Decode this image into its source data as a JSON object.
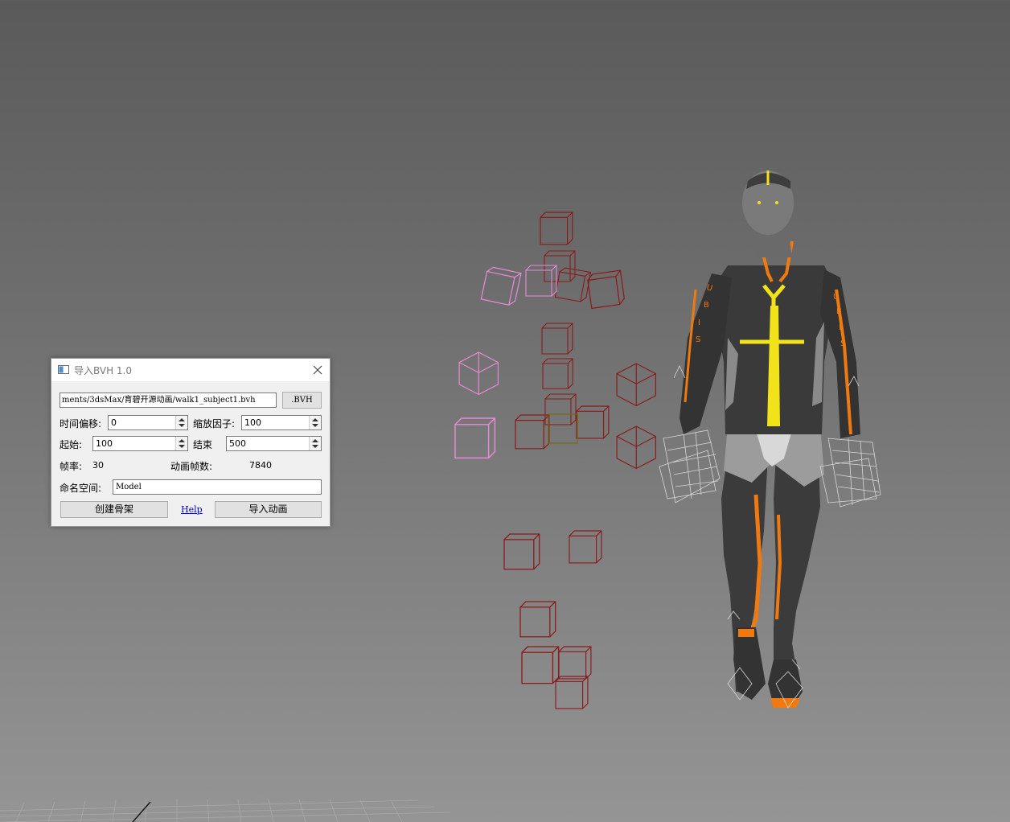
{
  "dialog": {
    "title": "导入BVH 1.0",
    "path_value": "ments/3dsMax/育碧开源动画/walk1_subject1.bvh",
    "browse_label": ".BVH",
    "time_offset_label": "时间偏移:",
    "time_offset_value": "0",
    "scale_label": "缩放因子:",
    "scale_value": "100",
    "start_label": "起始:",
    "start_value": "100",
    "end_label": "结束",
    "end_value": "500",
    "fps_label": "帧率:",
    "fps_value": "30",
    "frames_label": "动画帧数:",
    "frames_value": "7840",
    "namespace_label": "命名空间:",
    "namespace_value": "Model",
    "create_skeleton_label": "创建骨架",
    "help_label": "Help",
    "import_anim_label": "导入动画"
  },
  "viewport": {
    "background_top": "#5a5a5a",
    "background_bottom": "#959595",
    "bone_color": "#8b1a1a",
    "selected_bone_color": "#e88ad8",
    "suit_color": "#3a3a3a",
    "suit_accent": "#f07a10",
    "suit_highlight": "#f2e21a"
  }
}
